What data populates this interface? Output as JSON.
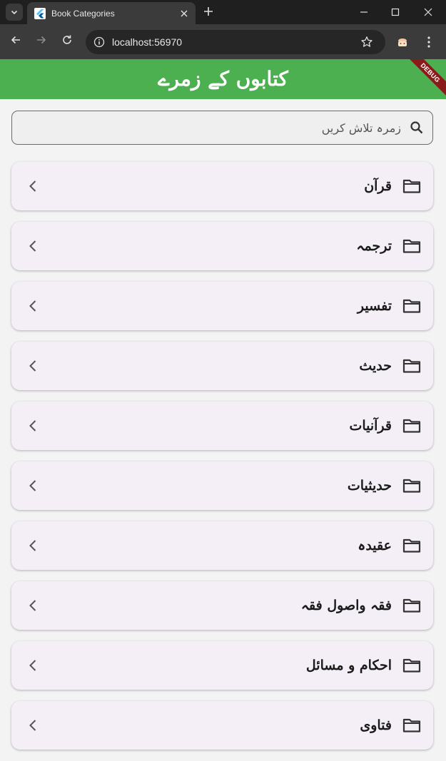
{
  "browser": {
    "tab_title": "Book Categories",
    "url": "localhost:56970"
  },
  "icons": {
    "tab_list": "chevron-down-icon",
    "tab_favicon": "flutter-icon",
    "tab_close": "close-icon",
    "new_tab": "plus-icon",
    "minimize": "minimize-icon",
    "maximize": "maximize-icon",
    "close_window": "close-icon",
    "back": "arrow-left-icon",
    "forward": "arrow-right-icon",
    "reload": "reload-icon",
    "site_info": "info-icon",
    "bookmark": "star-icon",
    "extension": "extension-icon",
    "menu": "kebab-menu-icon",
    "search": "search-icon",
    "folder": "folder-icon",
    "chevron": "chevron-left-icon"
  },
  "app": {
    "title": "کتابوں کے زمرے",
    "debug_label": "DEBUG",
    "theme_color": "#4caf50",
    "search": {
      "placeholder": "زمرہ تلاش کریں",
      "value": ""
    },
    "categories": [
      {
        "label": "قرآن"
      },
      {
        "label": "ترجمہ"
      },
      {
        "label": "تفسیر"
      },
      {
        "label": "حدیث"
      },
      {
        "label": "قرآنیات"
      },
      {
        "label": "حدیثیات"
      },
      {
        "label": "عقیدہ"
      },
      {
        "label": "فقہ واصول فقہ"
      },
      {
        "label": "احکام و مسائل"
      },
      {
        "label": "فتاوی"
      }
    ]
  }
}
